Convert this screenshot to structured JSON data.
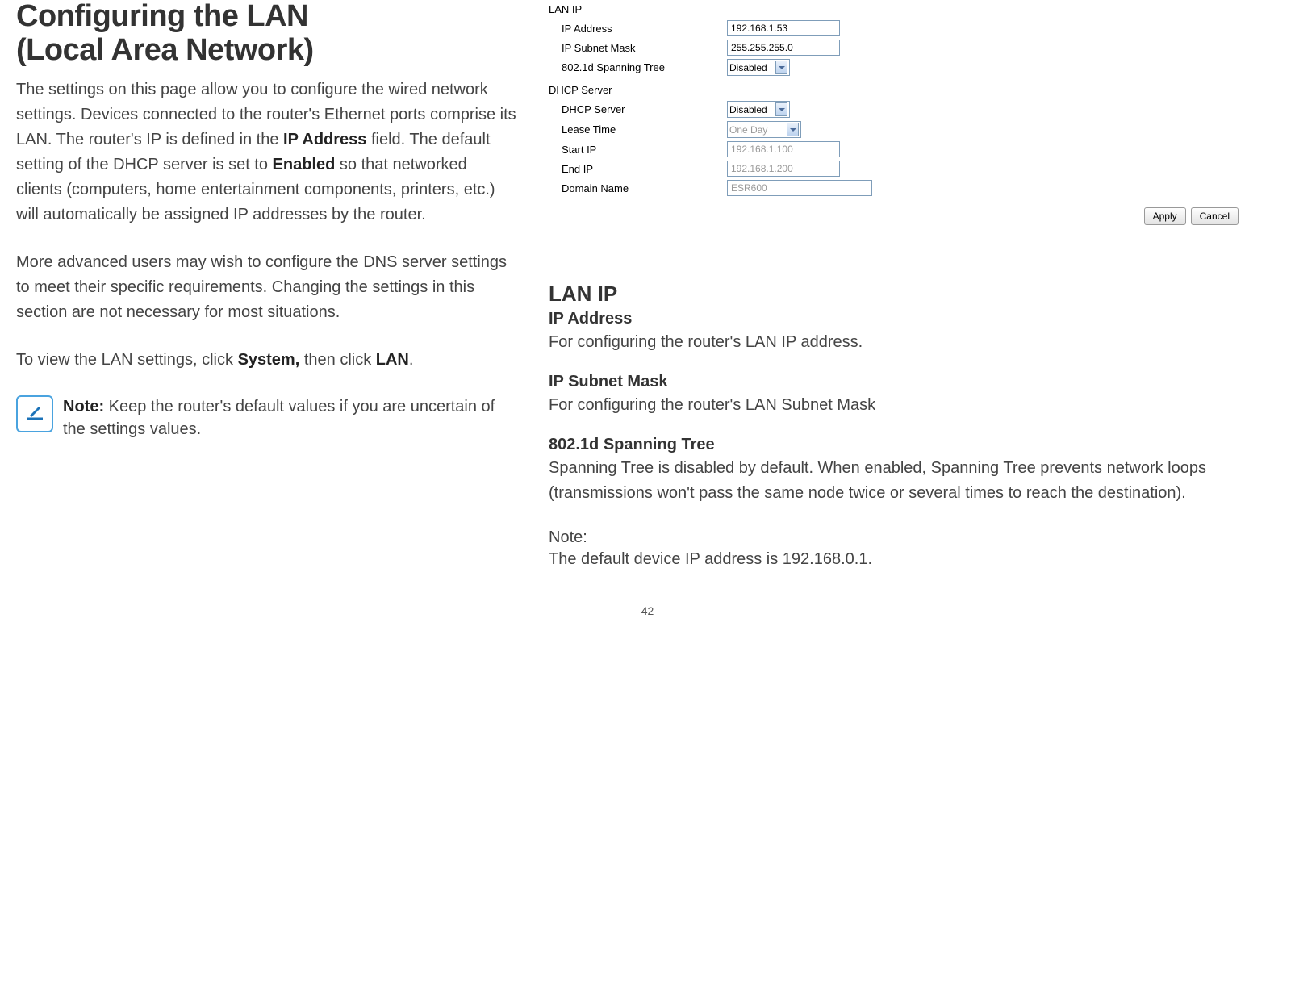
{
  "title_line1": "Configuring the LAN",
  "title_line2": "(Local Area Network)",
  "para1_a": "The settings on this page allow you to configure the wired network settings. Devices connected to the router's Ethernet ports comprise its LAN. The router's IP is defined in the ",
  "para1_b_bold": "IP Address",
  "para1_c": " field. The default setting of the DHCP server is set to ",
  "para1_d_bold": "Enabled",
  "para1_e": " so that networked clients (computers, home entertainment components, printers, etc.) will automatically be assigned IP addresses by the router.",
  "para2": "More advanced users may wish to configure the DNS server settings to meet their specific requirements. Changing the settings in this section are not necessary for most situations.",
  "para3_a": "To view the LAN settings, click ",
  "para3_b_bold": "System,",
  "para3_c": " then click ",
  "para3_d_bold": "LAN",
  "para3_e": ".",
  "note_bold": "Note:",
  "note_text": " Keep the router's default values if you are uncertain of the settings values.",
  "panel": {
    "lan_ip_header": "LAN IP",
    "ip_address_label": "IP Address",
    "ip_address_value": "192.168.1.53",
    "ip_subnet_label": "IP Subnet Mask",
    "ip_subnet_value": "255.255.255.0",
    "spanning_label": "802.1d Spanning Tree",
    "spanning_value": "Disabled",
    "dhcp_header": "DHCP Server",
    "dhcp_server_label": "DHCP Server",
    "dhcp_server_value": "Disabled",
    "lease_label": "Lease Time",
    "lease_value": "One Day",
    "start_ip_label": "Start IP",
    "start_ip_value": "192.168.1.100",
    "end_ip_label": "End IP",
    "end_ip_value": "192.168.1.200",
    "domain_label": "Domain Name",
    "domain_value": "ESR600",
    "apply_btn": "Apply",
    "cancel_btn": "Cancel"
  },
  "desc": {
    "h2": "LAN IP",
    "ip_addr_h": "IP Address",
    "ip_addr_p": "For configuring the router's LAN IP address.",
    "subnet_h": "IP Subnet Mask",
    "subnet_p": "For configuring the router's LAN Subnet Mask",
    "spanning_h": "802.1d Spanning Tree",
    "spanning_p": "Spanning Tree is disabled by default. When enabled, Spanning Tree prevents network loops (transmissions won't pass the same node twice or several times to reach the destination).",
    "note_label": "Note:",
    "note_p": "The default device IP address is 192.168.0.1."
  },
  "page_number": "42"
}
